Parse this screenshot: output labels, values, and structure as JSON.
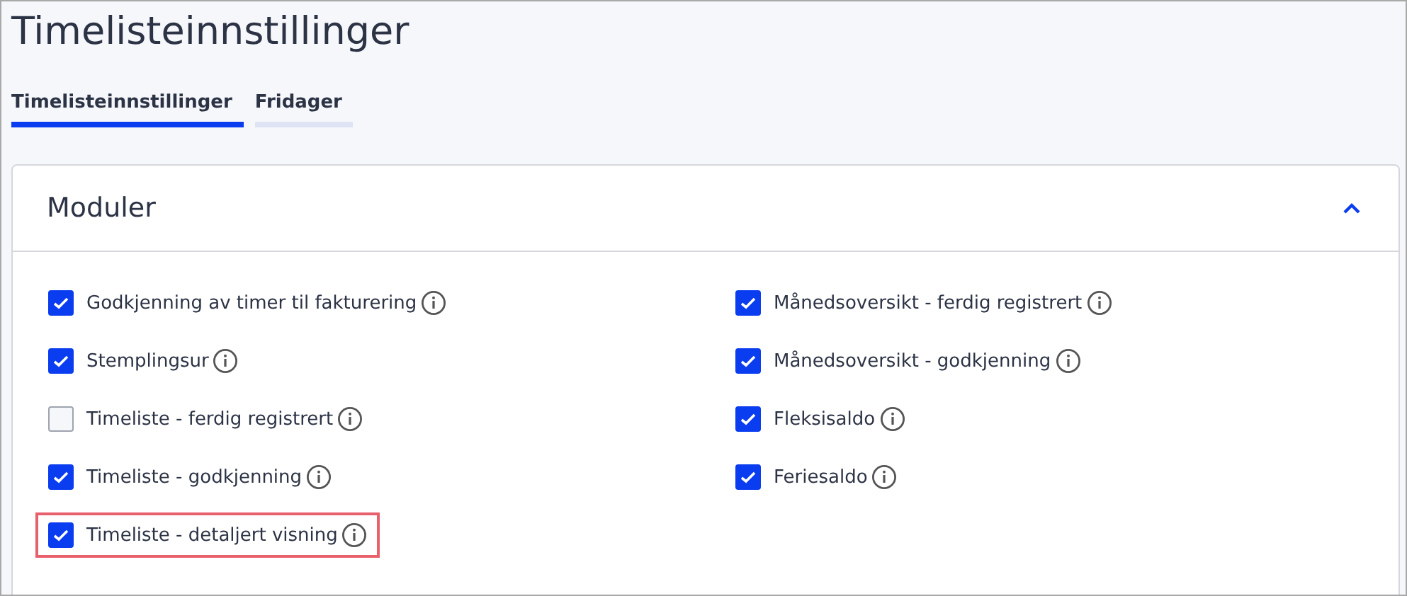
{
  "page": {
    "title": "Timelisteinnstillinger"
  },
  "tabs": [
    {
      "label": "Timelisteinnstillinger",
      "selected": true
    },
    {
      "label": "Fridager",
      "selected": false
    }
  ],
  "panel": {
    "title": "Moduler",
    "expanded": true,
    "columns": [
      [
        {
          "label": "Godkjenning av timer til fakturering",
          "checked": true,
          "highlighted": false
        },
        {
          "label": "Stemplingsur",
          "checked": true,
          "highlighted": false
        },
        {
          "label": "Timeliste - ferdig registrert",
          "checked": false,
          "highlighted": false
        },
        {
          "label": "Timeliste - godkjenning",
          "checked": true,
          "highlighted": false
        },
        {
          "label": "Timeliste - detaljert visning",
          "checked": true,
          "highlighted": true
        }
      ],
      [
        {
          "label": "Månedsoversikt - ferdig registrert",
          "checked": true,
          "highlighted": false
        },
        {
          "label": "Månedsoversikt - godkjenning",
          "checked": true,
          "highlighted": false
        },
        {
          "label": "Fleksisaldo",
          "checked": true,
          "highlighted": false
        },
        {
          "label": "Feriesaldo",
          "checked": true,
          "highlighted": false
        }
      ]
    ]
  }
}
